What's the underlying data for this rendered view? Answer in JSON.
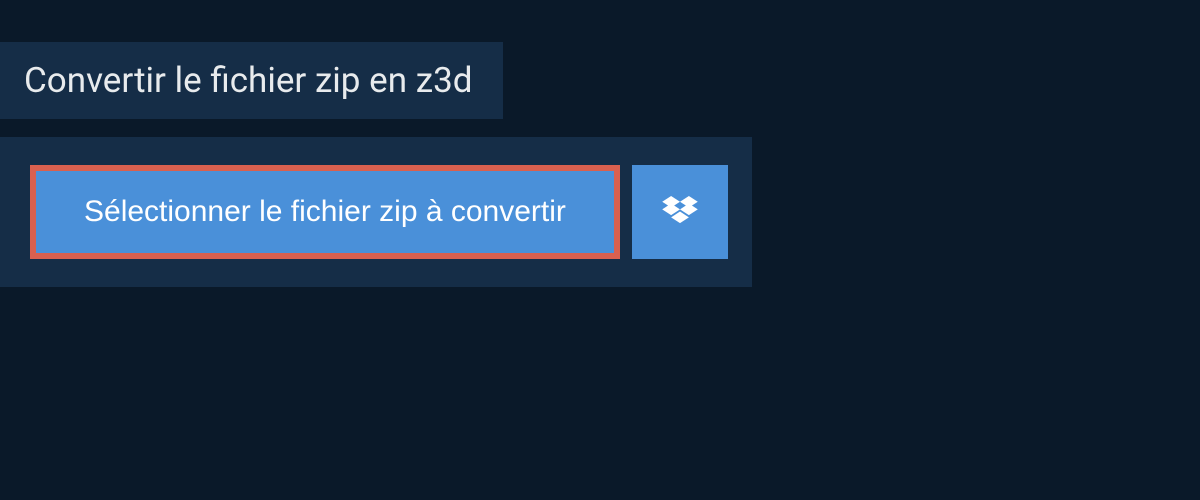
{
  "title": "Convertir le fichier zip en z3d",
  "select_button_label": "Sélectionner le fichier zip à convertir"
}
